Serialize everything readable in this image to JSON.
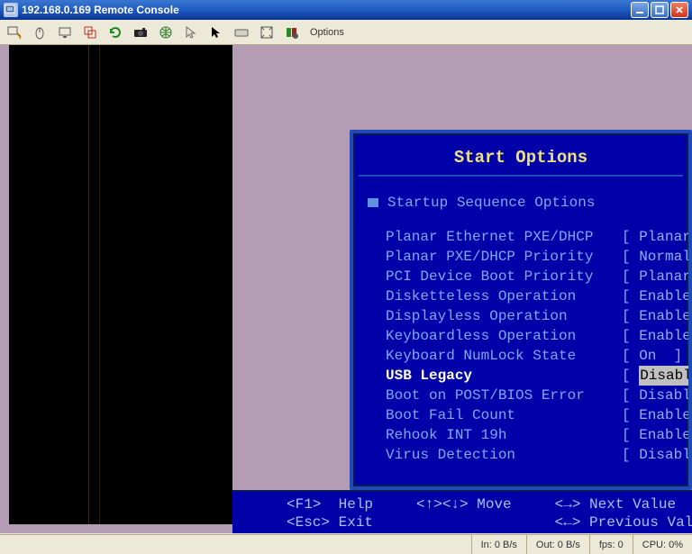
{
  "window": {
    "title": "192.168.0.169 Remote Console"
  },
  "toolbar": {
    "options_label": "Options"
  },
  "bios": {
    "title": "Start Options",
    "section": "Startup Sequence Options",
    "items": [
      {
        "label": "Planar Ethernet PXE/DHCP",
        "value": "Planar E"
      },
      {
        "label": "Planar PXE/DHCP Priority",
        "value": "Normal ]"
      },
      {
        "label": "PCI Device Boot Priority",
        "value": "Planar S"
      },
      {
        "label": "Disketteless Operation",
        "value": "Enabled"
      },
      {
        "label": "Displayless Operation",
        "value": "Enabled"
      },
      {
        "label": "Keyboardless Operation",
        "value": "Enabled"
      },
      {
        "label": "Keyboard NumLock State",
        "value": "On  ]"
      },
      {
        "label": "USB Legacy",
        "value": "Disabled",
        "selected": true
      },
      {
        "label": "Boot on POST/BIOS Error",
        "value": "Disabled"
      },
      {
        "label": "Boot Fail Count",
        "value": "Enabled"
      },
      {
        "label": "Rehook INT 19h",
        "value": "Enabled"
      },
      {
        "label": "Virus Detection",
        "value": "Disabled"
      }
    ],
    "footer_line1": "<F1>  Help     <↑><↓> Move     <→> Next Value",
    "footer_line2": "<Esc> Exit                     <←> Previous Value"
  },
  "statusbar": {
    "in": "In: 0 B/s",
    "out": "Out: 0 B/s",
    "fps": "fps: 0",
    "cpu": "CPU:  0%"
  }
}
